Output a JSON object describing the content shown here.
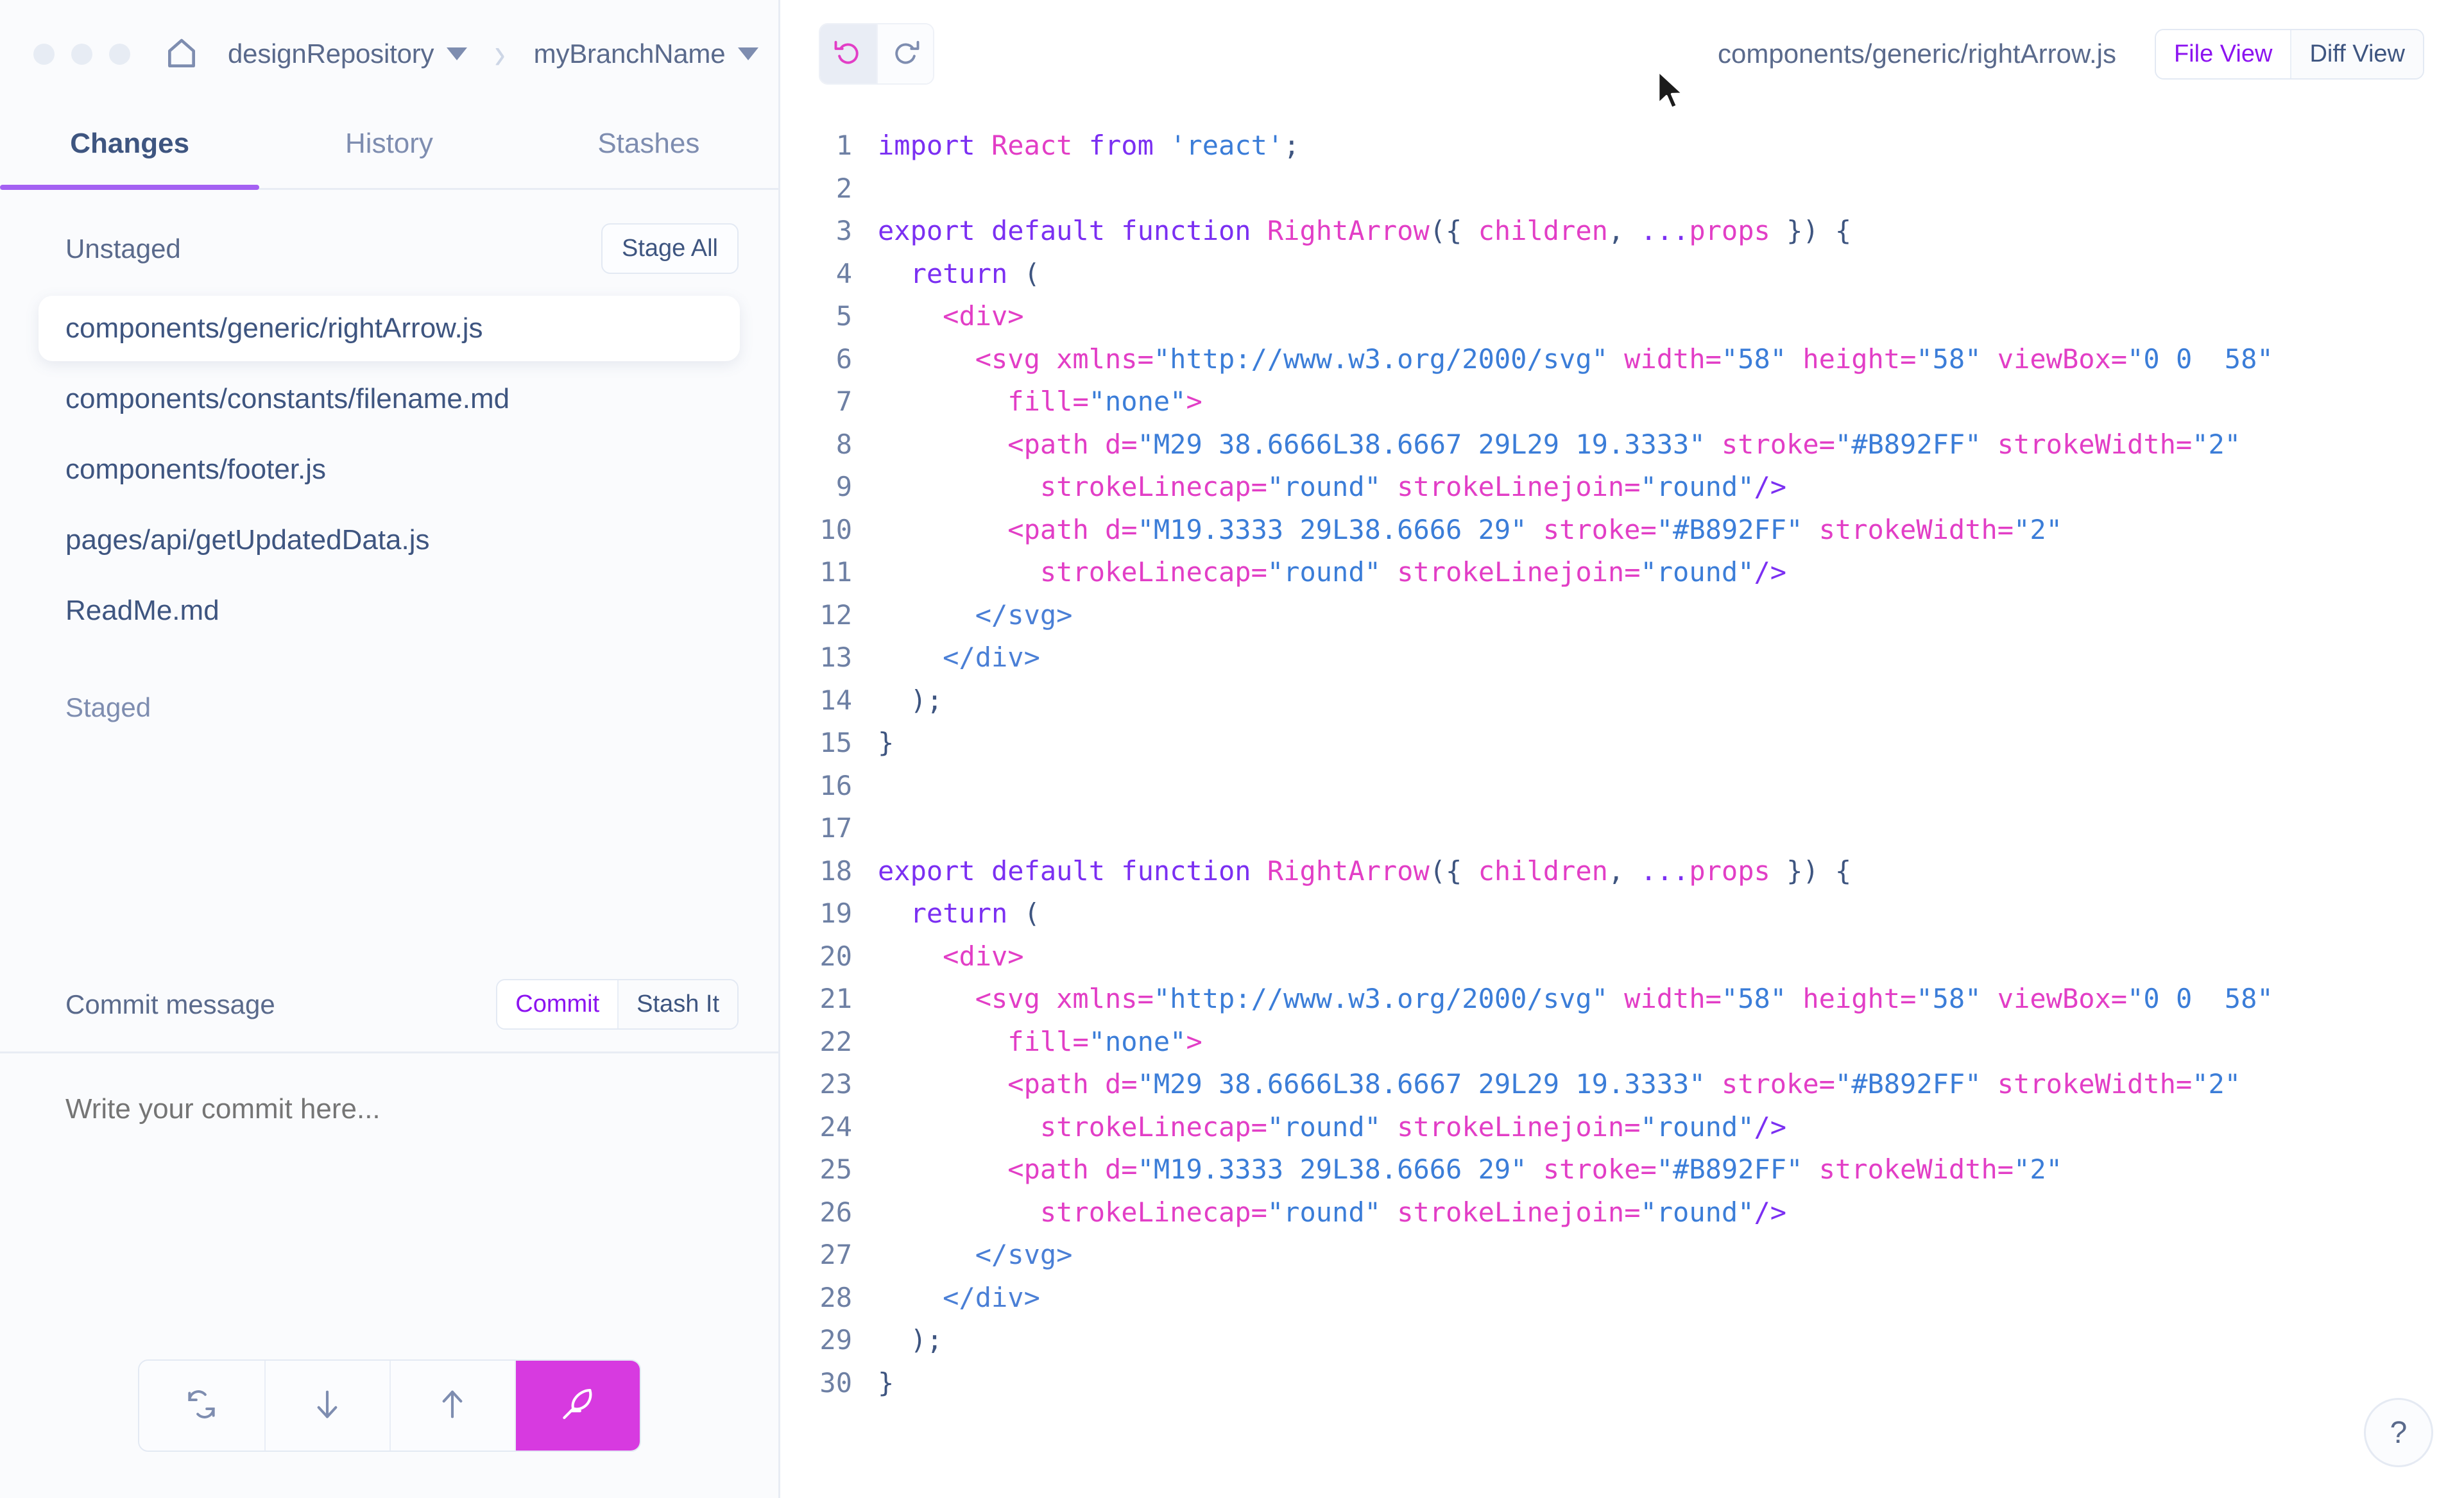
{
  "window": {
    "traffic_dots": 3,
    "home_icon": "home-icon"
  },
  "breadcrumb": {
    "repository": "designRepository",
    "separator": "›",
    "branch": "myBranchName"
  },
  "tabs": [
    {
      "label": "Changes",
      "active": true
    },
    {
      "label": "History",
      "active": false
    },
    {
      "label": "Stashes",
      "active": false
    }
  ],
  "unstaged": {
    "title": "Unstaged",
    "stage_all_label": "Stage All",
    "files": [
      {
        "path": "components/generic/rightArrow.js",
        "selected": true
      },
      {
        "path": "components/constants/filename.md",
        "selected": false
      },
      {
        "path": "components/footer.js",
        "selected": false
      },
      {
        "path": "pages/api/getUpdatedData.js",
        "selected": false
      },
      {
        "path": "ReadMe.md",
        "selected": false
      }
    ]
  },
  "staged": {
    "title": "Staged",
    "files": []
  },
  "commit": {
    "label": "Commit message",
    "commit_button": "Commit",
    "stash_button": "Stash It",
    "placeholder": "Write your commit here...",
    "value": ""
  },
  "bottom_actions": [
    {
      "name": "sync-button",
      "icon": "sync-icon",
      "primary": false
    },
    {
      "name": "pull-button",
      "icon": "arrow-down-icon",
      "primary": false
    },
    {
      "name": "push-button",
      "icon": "arrow-up-icon",
      "primary": false
    },
    {
      "name": "commit-feather-button",
      "icon": "feather-icon",
      "primary": true
    }
  ],
  "main_toolbar": {
    "undo_icon": "undo-icon",
    "redo_icon": "redo-icon",
    "undo_active": true,
    "file_path": "components/generic/rightArrow.js",
    "views": [
      {
        "label": "File View",
        "active": true
      },
      {
        "label": "Diff View",
        "active": false
      }
    ]
  },
  "help": {
    "label": "?"
  },
  "colors": {
    "accent_purple": "#a461f2",
    "accent_magenta": "#d73ae0",
    "active_link": "#8c13f0",
    "text_primary": "#3e5580",
    "text_muted": "#7e8db0",
    "sidebar_bg": "#fafbfd",
    "border": "#e8ecf4",
    "syntax_keyword": "#7b2ff2",
    "syntax_identifier": "#e23ec6",
    "syntax_string": "#3b7dd8",
    "syntax_punct": "#3e5580",
    "syntax_tag": "#4a7fd6"
  },
  "code": {
    "language": "jsx",
    "line_count": 30,
    "lines": [
      {
        "n": 1,
        "tokens": [
          {
            "t": "import ",
            "c": "k"
          },
          {
            "t": "React",
            "c": "id"
          },
          {
            "t": " from ",
            "c": "k"
          },
          {
            "t": "'react'",
            "c": "s"
          },
          {
            "t": ";",
            "c": "p"
          }
        ]
      },
      {
        "n": 2,
        "tokens": []
      },
      {
        "n": 3,
        "tokens": [
          {
            "t": "export default function ",
            "c": "k"
          },
          {
            "t": "RightArrow",
            "c": "id"
          },
          {
            "t": "({ ",
            "c": "p"
          },
          {
            "t": "children",
            "c": "id"
          },
          {
            "t": ", ",
            "c": "p"
          },
          {
            "t": "...",
            "c": "k"
          },
          {
            "t": "props",
            "c": "id"
          },
          {
            "t": " }) {",
            "c": "p"
          }
        ]
      },
      {
        "n": 4,
        "tokens": [
          {
            "t": "  ",
            "c": "p"
          },
          {
            "t": "return",
            "c": "k"
          },
          {
            "t": " (",
            "c": "p"
          }
        ]
      },
      {
        "n": 5,
        "tokens": [
          {
            "t": "    ",
            "c": "p"
          },
          {
            "t": "<div>",
            "c": "id"
          }
        ]
      },
      {
        "n": 6,
        "tokens": [
          {
            "t": "      ",
            "c": "p"
          },
          {
            "t": "<svg xmlns=",
            "c": "id"
          },
          {
            "t": "\"http://www.w3.org/2000/svg\"",
            "c": "s"
          },
          {
            "t": " width=",
            "c": "id"
          },
          {
            "t": "\"58\"",
            "c": "s"
          },
          {
            "t": " height=",
            "c": "id"
          },
          {
            "t": "\"58\"",
            "c": "s"
          },
          {
            "t": " viewBox=",
            "c": "id"
          },
          {
            "t": "\"0 0  58\"",
            "c": "s"
          }
        ]
      },
      {
        "n": 7,
        "tokens": [
          {
            "t": "        ",
            "c": "p"
          },
          {
            "t": "fill=",
            "c": "id"
          },
          {
            "t": "\"none\"",
            "c": "s"
          },
          {
            "t": ">",
            "c": "id"
          }
        ]
      },
      {
        "n": 8,
        "tokens": [
          {
            "t": "        ",
            "c": "p"
          },
          {
            "t": "<path d=",
            "c": "id"
          },
          {
            "t": "\"M29 38.6666L38.6667 29L29 19.3333\"",
            "c": "s"
          },
          {
            "t": " stroke=",
            "c": "id"
          },
          {
            "t": "\"#B892FF\"",
            "c": "s"
          },
          {
            "t": " strokeWidth=",
            "c": "id"
          },
          {
            "t": "\"2\"",
            "c": "s"
          }
        ]
      },
      {
        "n": 9,
        "tokens": [
          {
            "t": "          ",
            "c": "p"
          },
          {
            "t": "strokeLinecap=",
            "c": "id"
          },
          {
            "t": "\"round\"",
            "c": "s"
          },
          {
            "t": " strokeLinejoin=",
            "c": "id"
          },
          {
            "t": "\"round\"",
            "c": "s"
          },
          {
            "t": "/>",
            "c": "k"
          }
        ]
      },
      {
        "n": 10,
        "tokens": [
          {
            "t": "        ",
            "c": "p"
          },
          {
            "t": "<path d=",
            "c": "id"
          },
          {
            "t": "\"M19.3333 29L38.6666 29\"",
            "c": "s"
          },
          {
            "t": " stroke=",
            "c": "id"
          },
          {
            "t": "\"#B892FF\"",
            "c": "s"
          },
          {
            "t": " strokeWidth=",
            "c": "id"
          },
          {
            "t": "\"2\"",
            "c": "s"
          }
        ]
      },
      {
        "n": 11,
        "tokens": [
          {
            "t": "          ",
            "c": "p"
          },
          {
            "t": "strokeLinecap=",
            "c": "id"
          },
          {
            "t": "\"round\"",
            "c": "s"
          },
          {
            "t": " strokeLinejoin=",
            "c": "id"
          },
          {
            "t": "\"round\"",
            "c": "s"
          },
          {
            "t": "/>",
            "c": "k"
          }
        ]
      },
      {
        "n": 12,
        "tokens": [
          {
            "t": "      ",
            "c": "p"
          },
          {
            "t": "</svg>",
            "c": "tg"
          }
        ]
      },
      {
        "n": 13,
        "tokens": [
          {
            "t": "    ",
            "c": "p"
          },
          {
            "t": "</div>",
            "c": "tg"
          }
        ]
      },
      {
        "n": 14,
        "tokens": [
          {
            "t": "  );",
            "c": "p"
          }
        ]
      },
      {
        "n": 15,
        "tokens": [
          {
            "t": "}",
            "c": "p"
          }
        ]
      },
      {
        "n": 16,
        "tokens": []
      },
      {
        "n": 17,
        "tokens": []
      },
      {
        "n": 18,
        "tokens": [
          {
            "t": "export default function ",
            "c": "k"
          },
          {
            "t": "RightArrow",
            "c": "id"
          },
          {
            "t": "({ ",
            "c": "p"
          },
          {
            "t": "children",
            "c": "id"
          },
          {
            "t": ", ",
            "c": "p"
          },
          {
            "t": "...",
            "c": "k"
          },
          {
            "t": "props",
            "c": "id"
          },
          {
            "t": " }) {",
            "c": "p"
          }
        ]
      },
      {
        "n": 19,
        "tokens": [
          {
            "t": "  ",
            "c": "p"
          },
          {
            "t": "return",
            "c": "k"
          },
          {
            "t": " (",
            "c": "p"
          }
        ]
      },
      {
        "n": 20,
        "tokens": [
          {
            "t": "    ",
            "c": "p"
          },
          {
            "t": "<div>",
            "c": "id"
          }
        ]
      },
      {
        "n": 21,
        "tokens": [
          {
            "t": "      ",
            "c": "p"
          },
          {
            "t": "<svg xmlns=",
            "c": "id"
          },
          {
            "t": "\"http://www.w3.org/2000/svg\"",
            "c": "s"
          },
          {
            "t": " width=",
            "c": "id"
          },
          {
            "t": "\"58\"",
            "c": "s"
          },
          {
            "t": " height=",
            "c": "id"
          },
          {
            "t": "\"58\"",
            "c": "s"
          },
          {
            "t": " viewBox=",
            "c": "id"
          },
          {
            "t": "\"0 0  58\"",
            "c": "s"
          }
        ]
      },
      {
        "n": 22,
        "tokens": [
          {
            "t": "        ",
            "c": "p"
          },
          {
            "t": "fill=",
            "c": "id"
          },
          {
            "t": "\"none\"",
            "c": "s"
          },
          {
            "t": ">",
            "c": "id"
          }
        ]
      },
      {
        "n": 23,
        "tokens": [
          {
            "t": "        ",
            "c": "p"
          },
          {
            "t": "<path d=",
            "c": "id"
          },
          {
            "t": "\"M29 38.6666L38.6667 29L29 19.3333\"",
            "c": "s"
          },
          {
            "t": " stroke=",
            "c": "id"
          },
          {
            "t": "\"#B892FF\"",
            "c": "s"
          },
          {
            "t": " strokeWidth=",
            "c": "id"
          },
          {
            "t": "\"2\"",
            "c": "s"
          }
        ]
      },
      {
        "n": 24,
        "tokens": [
          {
            "t": "          ",
            "c": "p"
          },
          {
            "t": "strokeLinecap=",
            "c": "id"
          },
          {
            "t": "\"round\"",
            "c": "s"
          },
          {
            "t": " strokeLinejoin=",
            "c": "id"
          },
          {
            "t": "\"round\"",
            "c": "s"
          },
          {
            "t": "/>",
            "c": "k"
          }
        ]
      },
      {
        "n": 25,
        "tokens": [
          {
            "t": "        ",
            "c": "p"
          },
          {
            "t": "<path d=",
            "c": "id"
          },
          {
            "t": "\"M19.3333 29L38.6666 29\"",
            "c": "s"
          },
          {
            "t": " stroke=",
            "c": "id"
          },
          {
            "t": "\"#B892FF\"",
            "c": "s"
          },
          {
            "t": " strokeWidth=",
            "c": "id"
          },
          {
            "t": "\"2\"",
            "c": "s"
          }
        ]
      },
      {
        "n": 26,
        "tokens": [
          {
            "t": "          ",
            "c": "p"
          },
          {
            "t": "strokeLinecap=",
            "c": "id"
          },
          {
            "t": "\"round\"",
            "c": "s"
          },
          {
            "t": " strokeLinejoin=",
            "c": "id"
          },
          {
            "t": "\"round\"",
            "c": "s"
          },
          {
            "t": "/>",
            "c": "k"
          }
        ]
      },
      {
        "n": 27,
        "tokens": [
          {
            "t": "      ",
            "c": "p"
          },
          {
            "t": "</svg>",
            "c": "tg"
          }
        ]
      },
      {
        "n": 28,
        "tokens": [
          {
            "t": "    ",
            "c": "p"
          },
          {
            "t": "</div>",
            "c": "tg"
          }
        ]
      },
      {
        "n": 29,
        "tokens": [
          {
            "t": "  );",
            "c": "p"
          }
        ]
      },
      {
        "n": 30,
        "tokens": [
          {
            "t": "}",
            "c": "p"
          }
        ]
      }
    ]
  }
}
